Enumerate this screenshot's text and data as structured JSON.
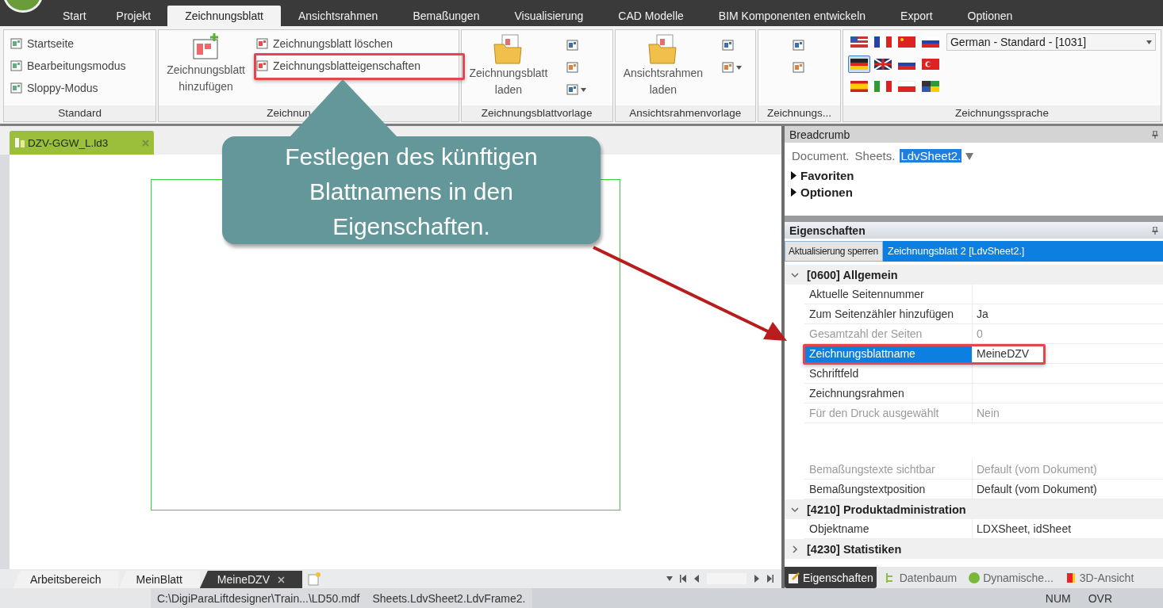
{
  "ribbon_tabs": [
    {
      "label": "Start",
      "selected": false
    },
    {
      "label": "Projekt",
      "selected": false
    },
    {
      "label": "Zeichnungsblatt",
      "selected": true
    },
    {
      "label": "Ansichtsrahmen",
      "selected": false
    },
    {
      "label": "Bemaßungen",
      "selected": false
    },
    {
      "label": "Visualisierung",
      "selected": false
    },
    {
      "label": "CAD Modelle",
      "selected": false
    },
    {
      "label": "BIM Komponenten entwickeln",
      "selected": false
    },
    {
      "label": "Export",
      "selected": false
    },
    {
      "label": "Optionen",
      "selected": false
    }
  ],
  "ribbon_groups": [
    {
      "title": "Standard",
      "items": [
        {
          "kind": "small",
          "label": "Startseite"
        },
        {
          "kind": "small",
          "label": "Bearbeitungsmodus"
        },
        {
          "kind": "small",
          "label": "Sloppy-Modus"
        }
      ]
    },
    {
      "title": "Zeichnun",
      "items": [
        {
          "kind": "large",
          "label": "Zeichnungsblatt hinzufügen"
        },
        {
          "kind": "small",
          "label": "Zeichnungsblatt löschen"
        },
        {
          "kind": "small",
          "label": "Zeichnungsblatteigenschaften"
        }
      ]
    },
    {
      "title": "Zeichnungsblattvorlage",
      "items": [
        {
          "kind": "large",
          "label": "Zeichnungsblatt laden"
        },
        {
          "kind": "icon",
          "caret": false
        },
        {
          "kind": "icon",
          "caret": false
        },
        {
          "kind": "icon",
          "caret": true
        }
      ]
    },
    {
      "title": "Ansichtsrahmenvorlage",
      "items": [
        {
          "kind": "large",
          "label": "Ansichtsrahmen laden"
        },
        {
          "kind": "icon",
          "caret": false
        },
        {
          "kind": "icon",
          "caret": true
        }
      ]
    },
    {
      "title": "Zeichnungs...",
      "items": [
        {
          "kind": "icon",
          "caret": false
        },
        {
          "kind": "icon",
          "caret": false
        }
      ]
    }
  ],
  "language_group": {
    "title": "Zeichnungssprache",
    "language": "German - Standard - [1031]",
    "flags": [
      {
        "kind": "us",
        "selected": false
      },
      {
        "kind": "fr",
        "selected": false
      },
      {
        "kind": "cn",
        "selected": false
      },
      {
        "kind": "si",
        "selected": false
      },
      {
        "kind": "de",
        "selected": true
      },
      {
        "kind": "gb",
        "selected": false
      },
      {
        "kind": "ru",
        "selected": false
      },
      {
        "kind": "tr",
        "selected": false
      },
      {
        "kind": "es",
        "selected": false
      },
      {
        "kind": "it",
        "selected": false
      },
      {
        "kind": "pl",
        "selected": false
      },
      {
        "kind": "multi",
        "selected": false
      }
    ]
  },
  "document_tab": {
    "label": "DZV-GGW_L.ld3"
  },
  "breadcrumb": {
    "title": "Breadcrumb",
    "segments": [
      {
        "label": "Document.",
        "selected": false
      },
      {
        "label": "Sheets.",
        "selected": false
      },
      {
        "label": "LdvSheet2.",
        "selected": true
      }
    ],
    "sections": [
      {
        "label": "Favoriten",
        "expanded": false
      },
      {
        "label": "Optionen",
        "expanded": false
      }
    ]
  },
  "properties": {
    "title": "Eigenschaften",
    "lock_button": "Aktualisierung sperren",
    "object": "Zeichnungsblatt 2 [LdvSheet2.]",
    "categories": [
      {
        "label": "[0600] Allgemein",
        "expanded": true,
        "rows": [
          {
            "name": "Aktuelle Seitennummer",
            "value": "",
            "selected": false,
            "disabled": false,
            "gap_before": false
          },
          {
            "name": "Zum Seitenzähler hinzufügen",
            "value": "Ja",
            "selected": false,
            "disabled": false,
            "gap_before": false
          },
          {
            "name": "Gesamtzahl der Seiten",
            "value": "0",
            "selected": false,
            "disabled": true,
            "gap_before": false
          },
          {
            "name": "Zeichnungsblattname",
            "value": "MeineDZV",
            "selected": true,
            "disabled": false,
            "gap_before": false
          },
          {
            "name": "Schriftfeld",
            "value": "",
            "selected": false,
            "disabled": false,
            "gap_before": false
          },
          {
            "name": "Zeichnungsrahmen",
            "value": "",
            "selected": false,
            "disabled": false,
            "gap_before": false
          },
          {
            "name": "Für den Druck ausgewählt",
            "value": "Nein",
            "selected": false,
            "disabled": true,
            "gap_before": false
          },
          {
            "name": "Bemaßungstexte sichtbar",
            "value": "Default (vom Dokument)",
            "selected": false,
            "disabled": true,
            "gap_before": true
          },
          {
            "name": "Bemaßungstextposition",
            "value": "Default (vom Dokument)",
            "selected": false,
            "disabled": false,
            "gap_before": false
          }
        ]
      },
      {
        "label": "[4210] Produktadministration",
        "expanded": true,
        "rows": [
          {
            "name": "Objektname",
            "value": "LDXSheet, idSheet",
            "selected": false,
            "disabled": false,
            "gap_before": false
          }
        ]
      },
      {
        "label": "[4230] Statistiken",
        "expanded": false
      }
    ]
  },
  "dock_tabs": [
    {
      "label": "Eigenschaften",
      "selected": true
    },
    {
      "label": "Datenbaum",
      "selected": false
    },
    {
      "label": "Dynamische...",
      "selected": false
    },
    {
      "label": "3D-Ansicht",
      "selected": false
    }
  ],
  "sheet_tabs": [
    {
      "label": "Arbeitsbereich",
      "selected": false
    },
    {
      "label": "MeinBlatt",
      "selected": false
    },
    {
      "label": "MeineDZV",
      "selected": true
    }
  ],
  "status_bar": {
    "path": "C:\\DigiParaLiftdesigner\\Train...\\LD50.mdf",
    "object": "Sheets.LdvSheet2.LdvFrame2.",
    "indicators": [
      "NUM",
      "OVR"
    ]
  },
  "callout": {
    "text": "Festlegen des künftigen Blattnamens in den Eigenschaften."
  }
}
